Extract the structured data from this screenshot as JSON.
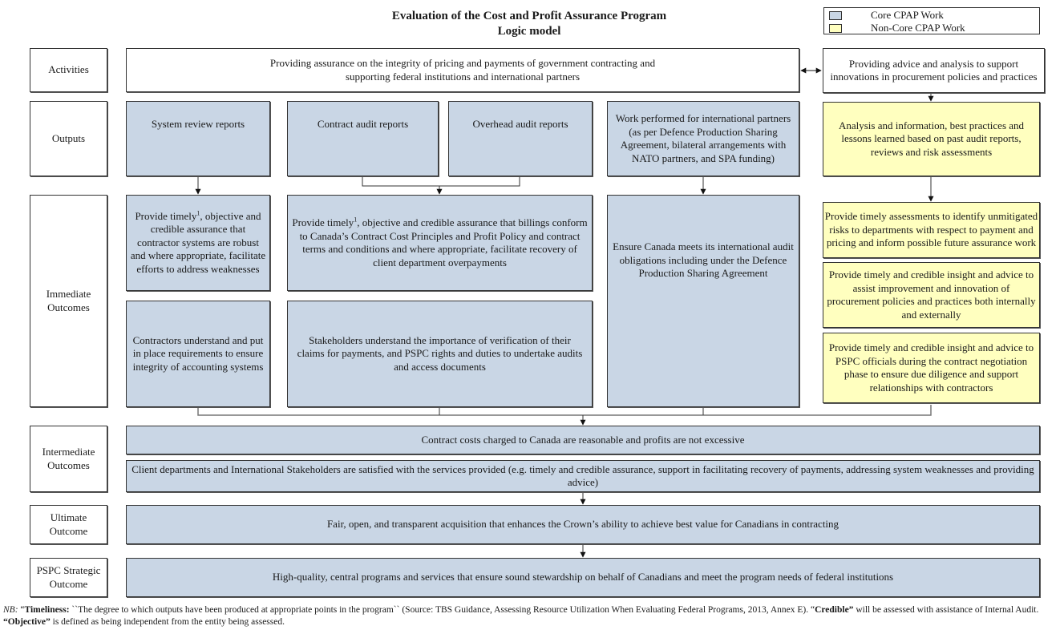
{
  "title": {
    "line1": "Evaluation of the Cost and Profit Assurance Program",
    "line2": "Logic model"
  },
  "legend": {
    "items": [
      {
        "label": "Core CPAP Work",
        "color": "#c9d6e5"
      },
      {
        "label": "Non-Core CPAP Work",
        "color": "#ffffbf"
      }
    ]
  },
  "rows": {
    "activities": "Activities",
    "outputs": "Outputs",
    "immediate": "Immediate Outcomes",
    "intermediate": "Intermediate Outcomes",
    "ultimate": "Ultimate Outcome",
    "strategic": "PSPC Strategic Outcome"
  },
  "activities": {
    "core": "Providing assurance on the integrity of pricing and payments of government contracting and supporting federal institutions and international partners",
    "noncore": "Providing advice and analysis to support innovations in procurement policies and practices"
  },
  "outputs": {
    "system_review": "System review reports",
    "contract_audit": "Contract audit reports",
    "overhead_audit": "Overhead audit reports",
    "international": "Work performed for international partners (as per Defence Production Sharing Agreement, bilateral arrangements with NATO partners, and SPA funding)",
    "analysis": "Analysis and information, best practices and lessons learned based on past audit reports, reviews and risk assessments"
  },
  "immediate": {
    "systems_assurance_pre": "Provide timely",
    "systems_assurance_sup": "1",
    "systems_assurance_post": ", objective and credible assurance that contractor systems are robust and where appropriate, facilitate efforts to address weaknesses",
    "billings_assurance_pre": "Provide timely",
    "billings_assurance_sup": "1",
    "billings_assurance_post": ", objective and credible assurance that billings conform to Canada’s Contract Cost Principles and Profit Policy and contract terms and conditions and where appropriate, facilitate recovery of client department overpayments",
    "contractors_understand": "Contractors understand and put in place requirements to ensure integrity of accounting systems",
    "stakeholders_understand": "Stakeholders understand the importance of verification of their claims for payments, and PSPC rights and duties to undertake audits and access documents",
    "international_obligations": "Ensure Canada meets its international audit obligations including under the Defence Production Sharing Agreement",
    "risk_assessments": "Provide timely assessments to identify unmitigated risks to departments with respect to payment and pricing and inform possible future assurance work",
    "procurement_insight": "Provide timely and credible insight and advice to assist improvement and innovation of procurement policies and practices both internally and externally",
    "negotiation_insight": "Provide timely and credible insight and advice to PSPC officials during the contract negotiation phase to ensure due diligence and support relationships with contractors"
  },
  "intermediate": {
    "costs": "Contract costs charged to Canada are reasonable and profits are not excessive",
    "satisfaction": "Client departments and International Stakeholders are satisfied with the services provided (e.g. timely and credible assurance, support in facilitating recovery of payments, addressing system weaknesses and providing advice)"
  },
  "ultimate": "Fair, open, and transparent acquisition that enhances the Crown’s ability to achieve best value for Canadians in contracting",
  "strategic": "High-quality, central programs and services that ensure sound stewardship on behalf of Canadians and meet the program needs of federal institutions",
  "footnote": {
    "nb": "NB:",
    "q1": " “",
    "timeliness_term": "Timeliness:",
    "timeliness_def": " ``The degree to which outputs have been produced at appropriate points in the program`` (Source: TBS Guidance, Assessing Resource Utilization When Evaluating Federal Programs, 2013, Annex E).  “",
    "credible_term": "Credible”",
    "credible_def": " will be assessed with assistance of Internal Audit.  ",
    "objective_term": "“Objective”",
    "objective_def": " is defined as being independent from the entity being assessed."
  }
}
